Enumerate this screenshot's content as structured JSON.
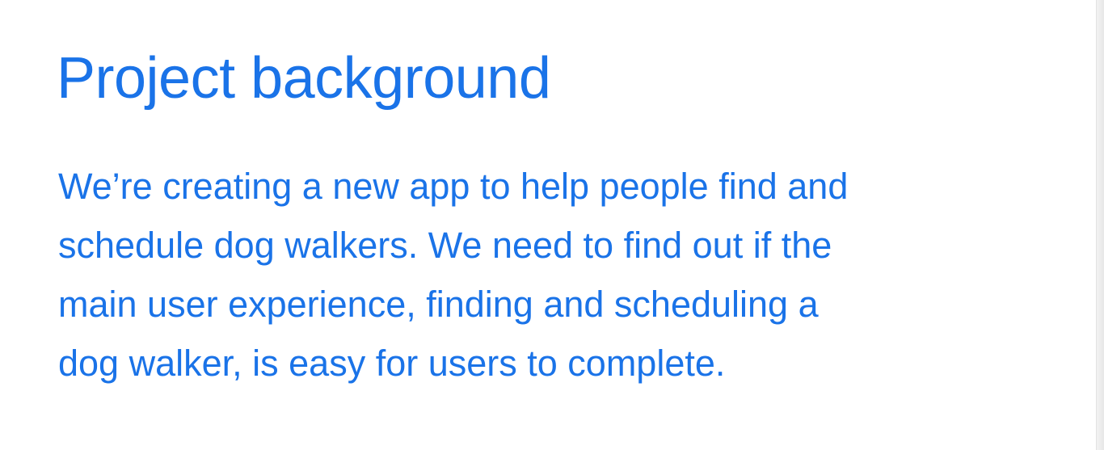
{
  "slide": {
    "title": "Project background",
    "body_lines": [
      "We’re creating a new app to help people find and",
      "schedule dog walkers. We need to find out if the",
      "main user experience, finding and scheduling a",
      "dog walker, is easy for users to complete."
    ]
  },
  "colors": {
    "text": "#1a73e8",
    "background": "#ffffff"
  }
}
